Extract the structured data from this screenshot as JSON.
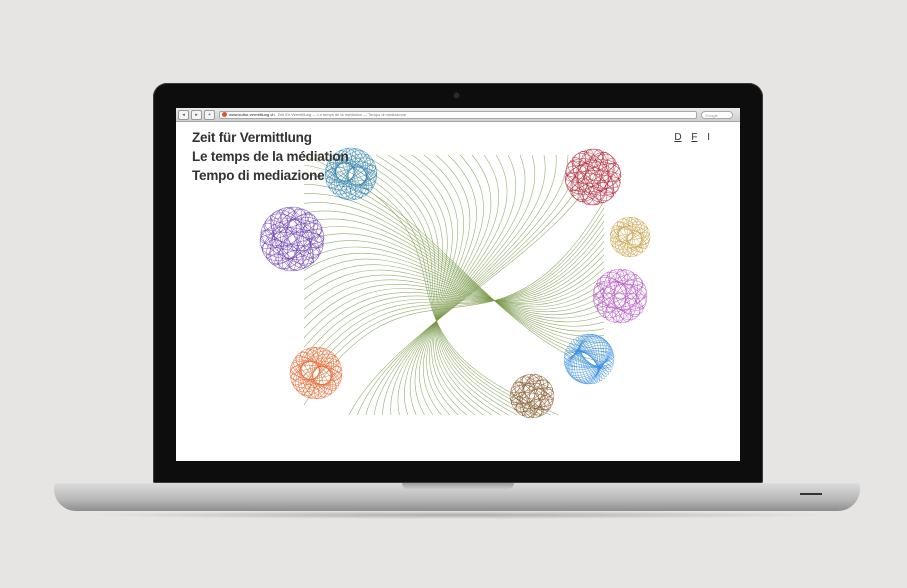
{
  "browser": {
    "url": "www.kultur-vermittlung.ch",
    "page_title": "Zeit für Vermittlung — Le temps de la médiation — Tempo di mediazione",
    "search_placeholder": "Google"
  },
  "site": {
    "titles": [
      "Zeit für Vermittlung",
      "Le temps de la médiation",
      "Tempo di mediazione"
    ],
    "languages": [
      "D",
      "F",
      "I"
    ]
  },
  "colors": {
    "green": "#7a9a4a",
    "blue": "#2a7fb0",
    "purple": "#6b3fb0",
    "red": "#b5243a",
    "gold": "#c8a24a",
    "magenta": "#b04cc0",
    "lightblue": "#3a8fe0",
    "brown": "#8a5a30",
    "orange": "#e8602a"
  }
}
